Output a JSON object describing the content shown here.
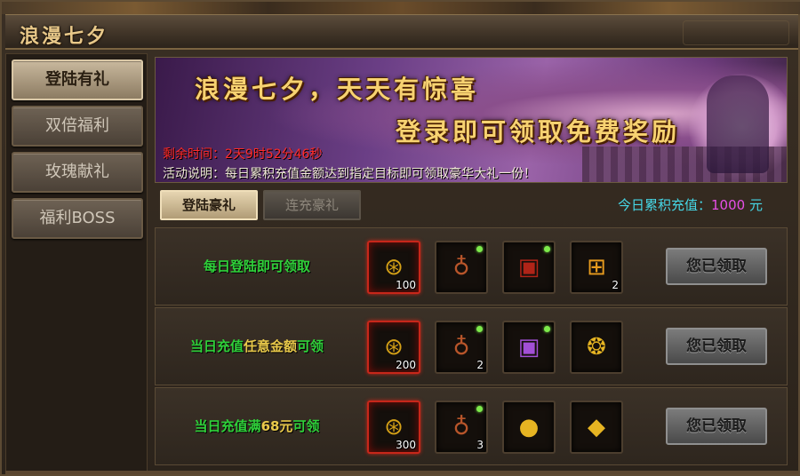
{
  "window": {
    "title": "浪漫七夕"
  },
  "sidebar": {
    "items": [
      {
        "label": "登陆有礼",
        "active": true
      },
      {
        "label": "双倍福利",
        "active": false
      },
      {
        "label": "玫瑰献礼",
        "active": false
      },
      {
        "label": "福利BOSS",
        "active": false
      }
    ]
  },
  "banner": {
    "headline": "浪漫七夕，天天有惊喜",
    "subheadline": "登录即可领取免费奖励",
    "timer_label": "剩余时间：",
    "timer_value": "2天9时52分46秒",
    "desc_label": "活动说明：",
    "desc_text": "每日累积充值金额达到指定目标即可领取豪华大礼一份！"
  },
  "tabs": [
    {
      "label": "登陆豪礼",
      "active": true
    },
    {
      "label": "连充豪礼",
      "active": false
    }
  ],
  "recharge": {
    "label": "今日累积充值：",
    "value": "1000",
    "unit": "元"
  },
  "rows": [
    {
      "label_parts": [
        "每日登陆即可领取",
        "",
        ""
      ],
      "items": [
        {
          "icon": "red-seal-token-icon",
          "count": "100",
          "new": false
        },
        {
          "icon": "loot-bag-icon",
          "count": "",
          "new": true
        },
        {
          "icon": "treasure-chest-icon",
          "count": "",
          "new": true
        },
        {
          "icon": "gift-box-icon",
          "count": "2",
          "new": false
        }
      ],
      "button": "您已领取"
    },
    {
      "label_parts": [
        "当日充值",
        "任意金额",
        "可领"
      ],
      "items": [
        {
          "icon": "red-seal-token-icon",
          "count": "200",
          "new": false
        },
        {
          "icon": "loot-bag-icon",
          "count": "2",
          "new": true
        },
        {
          "icon": "purple-chest-icon",
          "count": "",
          "new": true
        },
        {
          "icon": "gold-ornament-icon",
          "count": "",
          "new": false
        }
      ],
      "button": "您已领取"
    },
    {
      "label_parts": [
        "当日充值满",
        "68元",
        "可领"
      ],
      "items": [
        {
          "icon": "red-seal-token-icon",
          "count": "300",
          "new": false
        },
        {
          "icon": "loot-bag-icon",
          "count": "3",
          "new": true
        },
        {
          "icon": "gold-orb-icon",
          "count": "",
          "new": false
        },
        {
          "icon": "gold-crystal-icon",
          "count": "",
          "new": false
        }
      ],
      "button": "您已领取"
    }
  ],
  "colors": {
    "timer": "#ff2a2a",
    "row_label": "#2fd13a",
    "row_highlight": "#e9c94a",
    "recharge_label": "#46d7e6",
    "recharge_value": "#e64fe6",
    "banner_text": "#f7d271"
  }
}
